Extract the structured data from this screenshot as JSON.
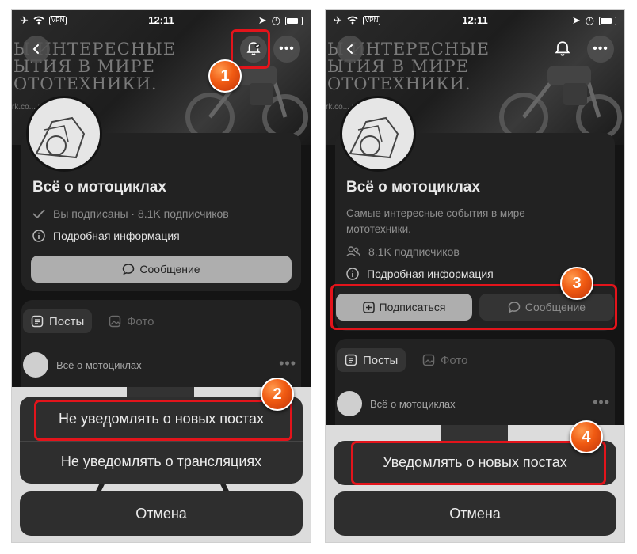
{
  "status": {
    "time": "12:11",
    "vpn": "VPN"
  },
  "cover": {
    "line1": "Ы ИНТЕРЕСНЫЕ",
    "line2": "ЫТИЯ В МИРЕ",
    "line3": "ОТОТЕХНИКИ.",
    "url": "rk.co... rcycles"
  },
  "left": {
    "group_name": "Всё о мотоциклах",
    "subscribed_line": "Вы подписаны · 8.1K подписчиков",
    "info": "Подробная информация",
    "message_button": "Сообщение",
    "tab_posts": "Посты",
    "tab_photos": "Фото",
    "post_author": "Всё о мотоциклах",
    "sheet_option1": "Не уведомлять о новых постах",
    "sheet_option2": "Не уведомлять о трансляциях",
    "cancel": "Отмена"
  },
  "right": {
    "group_name": "Всё о мотоциклах",
    "description": "Самые интересные события в мире мототехники.",
    "subscribers": "8.1K подписчиков",
    "info": "Подробная информация",
    "subscribe_button": "Подписаться",
    "message_button": "Сообщение",
    "tab_posts": "Посты",
    "tab_photos": "Фото",
    "post_author": "Всё о мотоциклах",
    "sheet_option": "Уведомлять о новых постах",
    "cancel": "Отмена"
  },
  "markers": [
    "1",
    "2",
    "3",
    "4"
  ],
  "colors": {
    "highlight": "#e3141b",
    "marker": "#f05a12",
    "background": "#141414"
  }
}
